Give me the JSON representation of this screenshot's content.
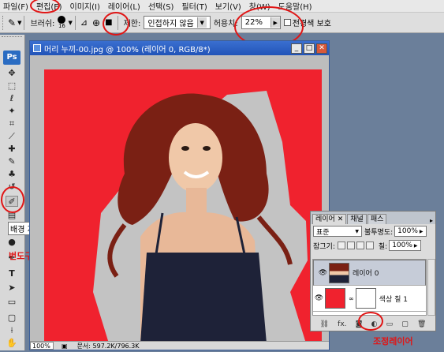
{
  "menu": [
    "파일(F)",
    "편집(E)",
    "이미지(I)",
    "레이어(L)",
    "선택(S)",
    "필터(T)",
    "보기(V)",
    "창(W)",
    "도움말(H)"
  ],
  "options": {
    "brush_label": "브러쉬:",
    "brush_size": "16",
    "limit_label": "제한:",
    "limit_value": "인접하지 않음",
    "tolerance_label": "허용치:",
    "tolerance_value": "22%",
    "protect_label": "전경색 보호"
  },
  "toolbox": {
    "ps_label": "Ps",
    "tooltip": "배경 지우개 도구",
    "annotation": "번도구"
  },
  "document": {
    "title": "머리 누끼-00.jpg @ 100% (레이어 0, RGB/8*)",
    "zoom": "100%",
    "doc_size": "문서: 597.2K/796.3K"
  },
  "layers_panel": {
    "tabs": [
      "레이어",
      "채널",
      "패스"
    ],
    "blend_mode": "표준",
    "opacity_label": "불투명도:",
    "opacity_value": "100%",
    "lock_label": "잠그기:",
    "fill_label": "칠:",
    "fill_value": "100%",
    "layers": [
      {
        "name": "레이어 0"
      },
      {
        "name": "색상 칠 1"
      }
    ],
    "annotation": "조정레이어"
  },
  "colors": {
    "canvas_red": "#f0222e",
    "accent_red": "#e01515",
    "title_blue": "#2a5fc4"
  }
}
